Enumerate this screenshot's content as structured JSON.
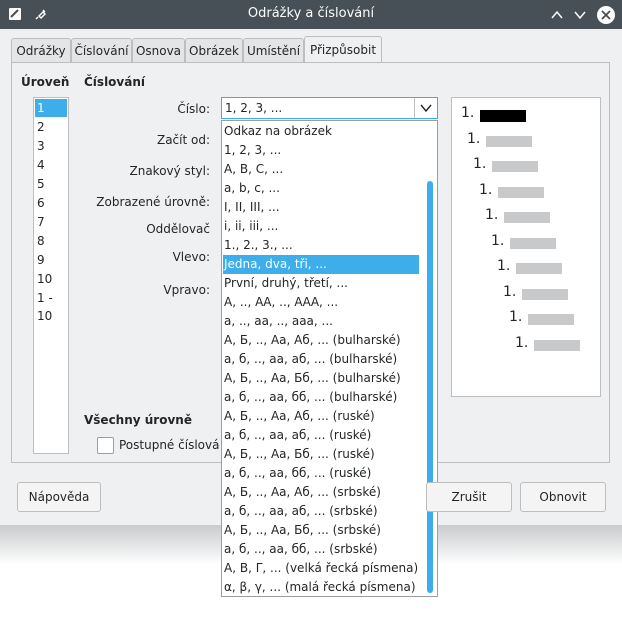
{
  "window": {
    "title": "Odrážky a číslování"
  },
  "tabs": [
    "Odrážky",
    "Číslování",
    "Osnova",
    "Obrázek",
    "Umístění",
    "Přizpůsobit"
  ],
  "level": {
    "heading": "Úroveň",
    "items": [
      "1",
      "2",
      "3",
      "4",
      "5",
      "6",
      "7",
      "8",
      "9",
      "10",
      "1 - 10"
    ],
    "selected": 0
  },
  "numbering": {
    "heading": "Číslování",
    "labels": {
      "number": "Číslo:",
      "start_at": "Začít od:",
      "char_style": "Znakový styl:",
      "show_sublevels": "Zobrazené úrovně:",
      "separator": "Oddělovač",
      "before": "Vlevo:",
      "after": "Vpravo:"
    },
    "number_value": "1, 2, 3, ...",
    "options": [
      "Odkaz na obrázek",
      "1, 2, 3, ...",
      "A, B, C, ...",
      "a, b, c, ...",
      "I, II, III, ...",
      "i, ii, iii, ...",
      "1., 2., 3., ...",
      "Jedna, dva, tři, ...",
      "První, druhý, třetí, ...",
      "А, .., АА, .., ААА, ...",
      "а, .., аа, .., ааа, ...",
      "А, Б, .., Аа, Аб, ... (bulharské)",
      "а, б, .., аа, аб, ... (bulharské)",
      "А, Б, .., Аа, Бб, ... (bulharské)",
      "а, б, .., аа, бб, ... (bulharské)",
      "А, Б, .., Аа, Аб, ... (ruské)",
      "а, б, .., аа, аб, ... (ruské)",
      "А, Б, .., Аа, Бб, ... (ruské)",
      "а, б, .., аа, бб, ... (ruské)",
      "А, Б, .., Аа, Аб, ... (srbské)",
      "а, б, .., аа, аб, ... (srbské)",
      "А, Б, .., Аа, Бб, ... (srbské)",
      "а, б, .., аа, бб, ... (srbské)",
      "Α, Β, Γ, ... (velká řecká písmena)",
      "α, β, γ, ... (malá řecká písmena)"
    ],
    "selected_option": 7,
    "scroll_thumb": {
      "start": 0.12,
      "end": 1.0
    }
  },
  "all_levels": {
    "heading": "Všechny úrovně",
    "consecutive_label": "Postupné číslová"
  },
  "preview": {
    "marker": "1."
  },
  "buttons": {
    "help": "Nápověda",
    "cancel": "Zrušit",
    "reset": "Obnovit"
  },
  "colors": {
    "accent": "#3daee9",
    "titlebar": "#475057"
  }
}
